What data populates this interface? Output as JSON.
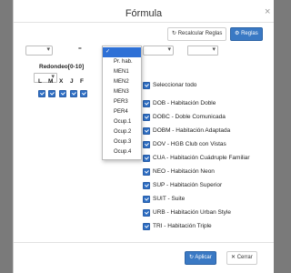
{
  "modal": {
    "title": "Fórmula",
    "close_glyph": "×"
  },
  "toolbar": {
    "recalcular_label": "Recalcular Reglas",
    "reglas_label": "Reglas"
  },
  "formula": {
    "equals": "="
  },
  "redondeo_label": "Redondeo[0-10]",
  "days": [
    "L",
    "M",
    "X",
    "J",
    "F"
  ],
  "dropdown": {
    "options": [
      "",
      "Pr. hab.",
      "MEN1",
      "MEN2",
      "MEN3",
      "PER3",
      "PER4",
      "Ocup.1",
      "Ocup.2",
      "Ocup.3",
      "Ocup.4"
    ],
    "selected_index": 0
  },
  "rooms": {
    "select_all": "Seleccionar todo",
    "items": [
      "DOB - Habitación Doble",
      "DOBC - Doble Comunicada",
      "DOBM - Habitación Adaptada",
      "DOV - HGB Club con Vistas",
      "CUA - Habitación Cuádruple Familiar",
      "NEO - Habitación Neon",
      "SUP - Habitación Superior",
      "SUIT - Suite",
      "URB - Habitación Urban Style",
      "TRI - Habitación Triple"
    ]
  },
  "footer": {
    "apply_label": "Aplicar",
    "close_label": "Cerrar"
  },
  "colors": {
    "primary": "#3a79c4",
    "selected": "#2e70d6",
    "checkbox": "#2f6fc4",
    "overlay": "#7a7a7a"
  }
}
